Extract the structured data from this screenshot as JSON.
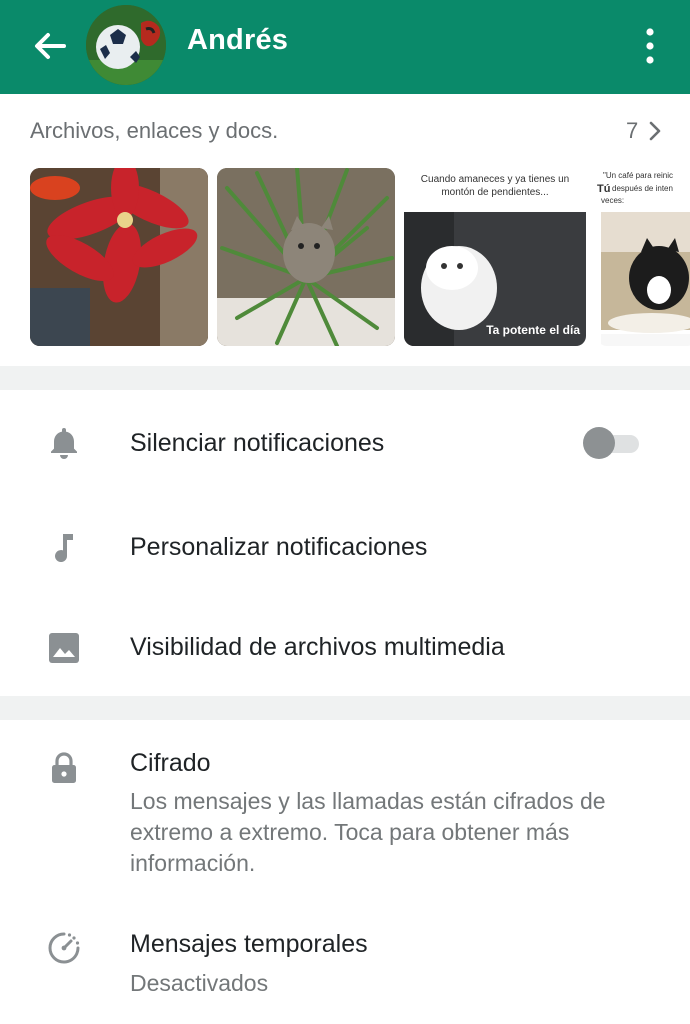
{
  "header": {
    "contact_name": "Andrés",
    "back_icon": "arrow-left-icon",
    "more_icon": "more-vertical-icon",
    "bar_color": "#0a8a6a"
  },
  "media": {
    "title": "Archivos, enlaces y docs.",
    "count": "7",
    "thumb3_caption_top": "Cuando amaneces y ya tienes un montón de pendientes...",
    "thumb3_caption_bottom": "Ta potente el día",
    "thumb4_caption_top": "\"Un café para reinic",
    "thumb4_caption_tu": "Tú",
    "thumb4_caption_rest": "después de inten",
    "thumb4_caption_line3": "veces:"
  },
  "settings": [
    {
      "icon": "bell-icon",
      "label": "Silenciar notificaciones",
      "toggle_on": false
    },
    {
      "icon": "music-note-icon",
      "label": "Personalizar notificaciones"
    },
    {
      "icon": "image-icon",
      "label": "Visibilidad de archivos multimedia"
    }
  ],
  "privacy": [
    {
      "icon": "lock-icon",
      "label": "Cifrado",
      "sub": "Los mensajes y las llamadas están cifrados de extremo a extremo. Toca para obtener más información."
    },
    {
      "icon": "timer-icon",
      "label": "Mensajes temporales",
      "sub": "Desactivados"
    }
  ]
}
